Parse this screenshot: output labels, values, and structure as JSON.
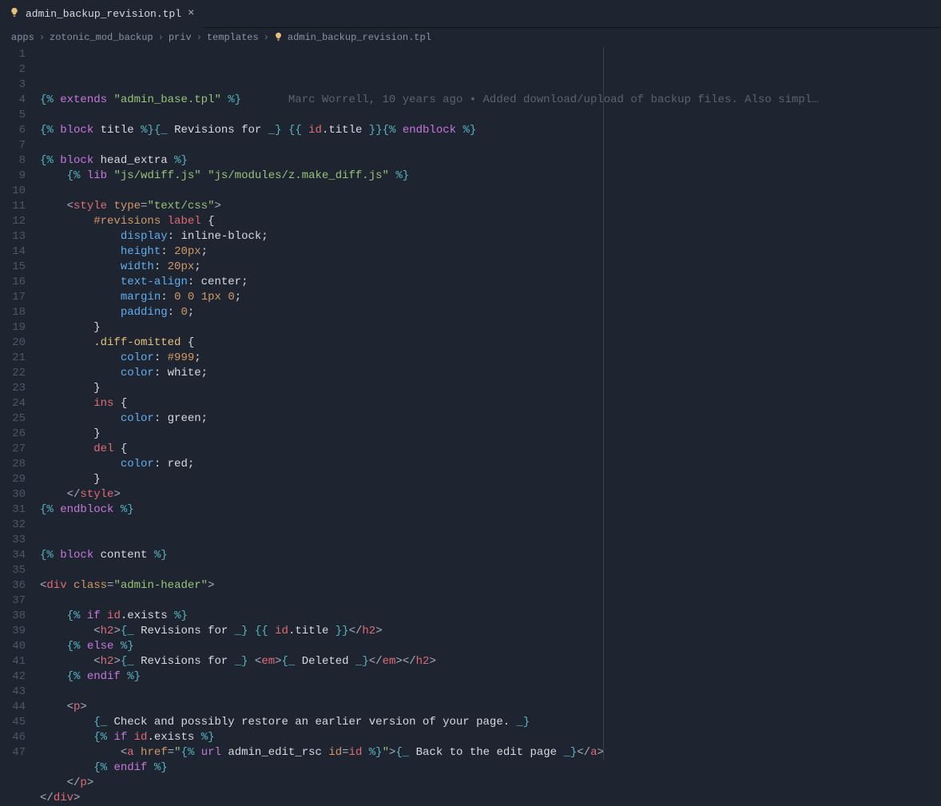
{
  "tab": {
    "filename": "admin_backup_revision.tpl",
    "icon": "lightbulb"
  },
  "breadcrumbs": {
    "parts": [
      "apps",
      "zotonic_mod_backup",
      "priv",
      "templates",
      "admin_backup_revision.tpl"
    ]
  },
  "blame": {
    "text": "Marc Worrell, 10 years ago • Added download/upload of backup files. Also simpl…"
  },
  "code": {
    "lines": [
      {
        "n": 1,
        "html": "<span class='brace'>{%</span> <span class='kw'>extends</span> <span class='str'>\"admin_base.tpl\"</span> <span class='brace'>%}</span>"
      },
      {
        "n": 2,
        "html": ""
      },
      {
        "n": 3,
        "html": "<span class='brace'>{%</span> <span class='kw'>block</span> <span class='white'>title</span> <span class='brace'>%}</span><span class='brace'>{_</span> <span class='white'>Revisions for</span> <span class='brace'>_}</span> <span class='brace'>{{</span> <span class='id'>id</span><span class='white'>.</span><span class='white'>title</span> <span class='brace'>}}</span><span class='brace'>{%</span> <span class='kw'>endblock</span> <span class='brace'>%}</span>"
      },
      {
        "n": 4,
        "html": ""
      },
      {
        "n": 5,
        "html": "<span class='brace'>{%</span> <span class='kw'>block</span> <span class='white'>head_extra</span> <span class='brace'>%}</span>"
      },
      {
        "n": 6,
        "html": "    <span class='brace'>{%</span> <span class='kw'>lib</span> <span class='str'>\"js/wdiff.js\"</span> <span class='str'>\"js/modules/z.make_diff.js\"</span> <span class='brace'>%}</span>"
      },
      {
        "n": 7,
        "html": ""
      },
      {
        "n": 8,
        "html": "    <span class='punct'>&lt;</span><span class='tag'>style</span> <span class='attr'>type</span><span class='punct'>=</span><span class='str'>\"text/css\"</span><span class='punct'>&gt;</span>"
      },
      {
        "n": 9,
        "html": "        <span class='sel'>#revisions</span> <span class='tag'>label</span> <span class='white'>{</span>"
      },
      {
        "n": 10,
        "html": "            <span class='fn'>display</span><span class='white'>:</span> <span class='white'>inline-block</span><span class='white'>;</span>"
      },
      {
        "n": 11,
        "html": "            <span class='fn'>height</span><span class='white'>:</span> <span class='num'>20px</span><span class='white'>;</span>"
      },
      {
        "n": 12,
        "html": "            <span class='fn'>width</span><span class='white'>:</span> <span class='num'>20px</span><span class='white'>;</span>"
      },
      {
        "n": 13,
        "html": "            <span class='fn'>text-align</span><span class='white'>:</span> <span class='white'>center</span><span class='white'>;</span>"
      },
      {
        "n": 14,
        "html": "            <span class='fn'>margin</span><span class='white'>:</span> <span class='num'>0</span> <span class='num'>0</span> <span class='num'>1px</span> <span class='num'>0</span><span class='white'>;</span>"
      },
      {
        "n": 15,
        "html": "            <span class='fn'>padding</span><span class='white'>:</span> <span class='num'>0</span><span class='white'>;</span>"
      },
      {
        "n": 16,
        "html": "        <span class='white'>}</span>"
      },
      {
        "n": 17,
        "html": "        <span class='ylw'>.diff-omitted</span> <span class='white'>{</span>"
      },
      {
        "n": 18,
        "html": "            <span class='fn'>color</span><span class='white'>:</span> <span class='num'>#999</span><span class='white'>;</span>"
      },
      {
        "n": 19,
        "html": "            <span class='fn'>color</span><span class='white'>:</span> <span class='white'>white</span><span class='white'>;</span>"
      },
      {
        "n": 20,
        "html": "        <span class='white'>}</span>"
      },
      {
        "n": 21,
        "html": "        <span class='tag'>ins</span> <span class='white'>{</span>"
      },
      {
        "n": 22,
        "html": "            <span class='fn'>color</span><span class='white'>:</span> <span class='white'>green</span><span class='white'>;</span>"
      },
      {
        "n": 23,
        "html": "        <span class='white'>}</span>"
      },
      {
        "n": 24,
        "html": "        <span class='tag'>del</span> <span class='white'>{</span>"
      },
      {
        "n": 25,
        "html": "            <span class='fn'>color</span><span class='white'>:</span> <span class='white'>red</span><span class='white'>;</span>"
      },
      {
        "n": 26,
        "html": "        <span class='white'>}</span>"
      },
      {
        "n": 27,
        "html": "    <span class='punct'>&lt;/</span><span class='tag'>style</span><span class='punct'>&gt;</span>"
      },
      {
        "n": 28,
        "html": "<span class='brace'>{%</span> <span class='kw'>endblock</span> <span class='brace'>%}</span>"
      },
      {
        "n": 29,
        "html": ""
      },
      {
        "n": 30,
        "html": ""
      },
      {
        "n": 31,
        "html": "<span class='brace'>{%</span> <span class='kw'>block</span> <span class='white'>content</span> <span class='brace'>%}</span>"
      },
      {
        "n": 32,
        "html": ""
      },
      {
        "n": 33,
        "html": "<span class='punct'>&lt;</span><span class='tag'>div</span> <span class='attr'>class</span><span class='punct'>=</span><span class='str'>\"admin-header\"</span><span class='punct'>&gt;</span>"
      },
      {
        "n": 34,
        "html": ""
      },
      {
        "n": 35,
        "html": "    <span class='brace'>{%</span> <span class='kw'>if</span> <span class='id'>id</span><span class='white'>.exists</span> <span class='brace'>%}</span>"
      },
      {
        "n": 36,
        "html": "        <span class='punct'>&lt;</span><span class='tag'>h2</span><span class='punct'>&gt;</span><span class='brace'>{_</span> <span class='white'>Revisions for</span> <span class='brace'>_}</span> <span class='brace'>{{</span> <span class='id'>id</span><span class='white'>.title</span> <span class='brace'>}}</span><span class='punct'>&lt;/</span><span class='tag'>h2</span><span class='punct'>&gt;</span>"
      },
      {
        "n": 37,
        "html": "    <span class='brace'>{%</span> <span class='kw'>else</span> <span class='brace'>%}</span>"
      },
      {
        "n": 38,
        "html": "        <span class='punct'>&lt;</span><span class='tag'>h2</span><span class='punct'>&gt;</span><span class='brace'>{_</span> <span class='white'>Revisions for</span> <span class='brace'>_}</span> <span class='punct'>&lt;</span><span class='tag'>em</span><span class='punct'>&gt;</span><span class='brace'>{_</span> <span class='white'>Deleted</span> <span class='brace'>_}</span><span class='punct'>&lt;/</span><span class='tag'>em</span><span class='punct'>&gt;</span><span class='punct'>&lt;/</span><span class='tag'>h2</span><span class='punct'>&gt;</span>"
      },
      {
        "n": 39,
        "html": "    <span class='brace'>{%</span> <span class='kw'>endif</span> <span class='brace'>%}</span>"
      },
      {
        "n": 40,
        "html": ""
      },
      {
        "n": 41,
        "html": "    <span class='punct'>&lt;</span><span class='tag'>p</span><span class='punct'>&gt;</span>"
      },
      {
        "n": 42,
        "html": "        <span class='brace'>{_</span> <span class='white'>Check and possibly restore an earlier version of your page.</span> <span class='brace'>_}</span>"
      },
      {
        "n": 43,
        "html": "        <span class='brace'>{%</span> <span class='kw'>if</span> <span class='id'>id</span><span class='white'>.exists</span> <span class='brace'>%}</span>"
      },
      {
        "n": 44,
        "html": "            <span class='punct'>&lt;</span><span class='tag'>a</span> <span class='attr'>href</span><span class='punct'>=</span><span class='str'>\"</span><span class='brace'>{%</span> <span class='kw'>url</span> <span class='white'>admin_edit_rsc</span> <span class='attr'>id</span><span class='punct'>=</span><span class='id'>id</span> <span class='brace'>%}</span><span class='str'>\"</span><span class='punct'>&gt;</span><span class='brace'>{_</span> <span class='white'>Back to the edit page</span> <span class='brace'>_}</span><span class='punct'>&lt;/</span><span class='tag'>a</span><span class='punct'>&gt;</span>"
      },
      {
        "n": 45,
        "html": "        <span class='brace'>{%</span> <span class='kw'>endif</span> <span class='brace'>%}</span>"
      },
      {
        "n": 46,
        "html": "    <span class='punct'>&lt;/</span><span class='tag'>p</span><span class='punct'>&gt;</span>"
      },
      {
        "n": 47,
        "html": "<span class='punct'>&lt;/</span><span class='tag'>div</span><span class='punct'>&gt;</span>"
      }
    ]
  }
}
